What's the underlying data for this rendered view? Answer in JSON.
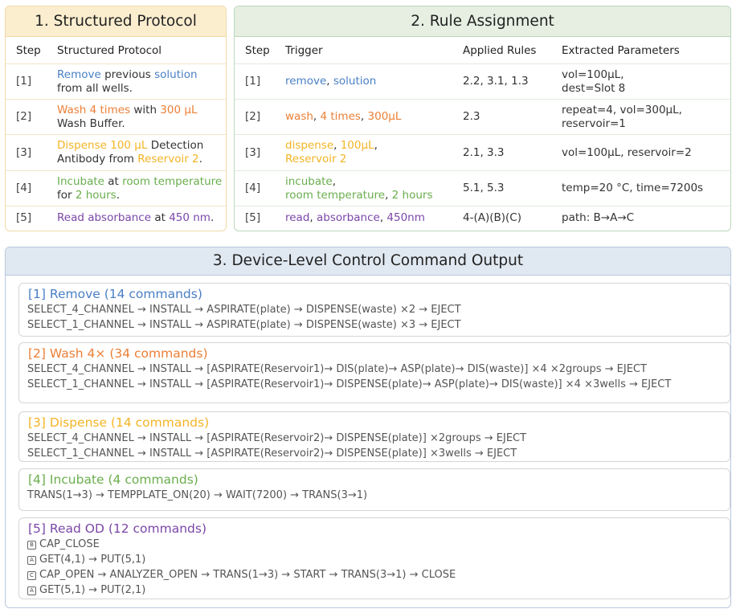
{
  "panel1": {
    "title": "1. Structured Protocol",
    "headers": [
      "Step",
      "Structured Protocol"
    ],
    "rows": [
      {
        "step": "[1]",
        "parts": [
          {
            "t": "Remove",
            "c": "blue"
          },
          {
            "t": " previous ",
            "c": "dark"
          },
          {
            "t": "solution",
            "c": "blue"
          },
          {
            "t": "\nfrom all wells.",
            "c": "dark"
          }
        ]
      },
      {
        "step": "[2]",
        "parts": [
          {
            "t": "Wash 4 times",
            "c": "orange"
          },
          {
            "t": " with ",
            "c": "dark"
          },
          {
            "t": "300 μL",
            "c": "orange"
          },
          {
            "t": "\nWash Buffer.",
            "c": "dark"
          }
        ]
      },
      {
        "step": "[3]",
        "parts": [
          {
            "t": "Dispense 100 μL",
            "c": "yellow"
          },
          {
            "t": " Detection\nAntibody from ",
            "c": "dark"
          },
          {
            "t": "Reservoir 2",
            "c": "yellow"
          },
          {
            "t": ".",
            "c": "dark"
          }
        ]
      },
      {
        "step": "[4]",
        "parts": [
          {
            "t": "Incubate",
            "c": "green"
          },
          {
            "t": " at ",
            "c": "dark"
          },
          {
            "t": "room temperature",
            "c": "green"
          },
          {
            "t": "\nfor ",
            "c": "dark"
          },
          {
            "t": "2 hours",
            "c": "green"
          },
          {
            "t": ".",
            "c": "dark"
          }
        ]
      },
      {
        "step": "[5]",
        "parts": [
          {
            "t": "Read absorbance",
            "c": "purple"
          },
          {
            "t": " at ",
            "c": "dark"
          },
          {
            "t": "450 nm",
            "c": "purple"
          },
          {
            "t": ".",
            "c": "dark"
          }
        ]
      }
    ]
  },
  "panel2": {
    "title": "2. Rule Assignment",
    "headers": [
      "Step",
      "Trigger",
      "Applied Rules",
      "Extracted Parameters"
    ],
    "rows": [
      {
        "step": "[1]",
        "trigger": [
          {
            "t": "remove",
            "c": "blue"
          },
          {
            "t": ", ",
            "c": "dark"
          },
          {
            "t": "solution",
            "c": "blue"
          }
        ],
        "rules": "2.2, 3.1, 1.3",
        "params": "vol=100μL,\ndest=Slot 8"
      },
      {
        "step": "[2]",
        "trigger": [
          {
            "t": "wash",
            "c": "orange"
          },
          {
            "t": ", ",
            "c": "dark"
          },
          {
            "t": "4 times",
            "c": "orange"
          },
          {
            "t": ", ",
            "c": "dark"
          },
          {
            "t": "300μL",
            "c": "orange"
          }
        ],
        "rules": "2.3",
        "params": "repeat=4, vol=300μL,\nreservoir=1"
      },
      {
        "step": "[3]",
        "trigger": [
          {
            "t": "dispense",
            "c": "yellow"
          },
          {
            "t": ", ",
            "c": "dark"
          },
          {
            "t": "100μL",
            "c": "yellow"
          },
          {
            "t": ",\n",
            "c": "dark"
          },
          {
            "t": "Reservoir 2",
            "c": "yellow"
          }
        ],
        "rules": "2.1, 3.3",
        "params": "vol=100μL, reservoir=2"
      },
      {
        "step": "[4]",
        "trigger": [
          {
            "t": "incubate",
            "c": "green"
          },
          {
            "t": ",\n",
            "c": "dark"
          },
          {
            "t": "room temperature",
            "c": "green"
          },
          {
            "t": ", ",
            "c": "dark"
          },
          {
            "t": "2 hours",
            "c": "green"
          }
        ],
        "rules": "5.1, 5.3",
        "params": "temp=20 °C, time=7200s"
      },
      {
        "step": "[5]",
        "trigger": [
          {
            "t": "read",
            "c": "purple"
          },
          {
            "t": ", ",
            "c": "dark"
          },
          {
            "t": "absorbance",
            "c": "purple"
          },
          {
            "t": ", ",
            "c": "dark"
          },
          {
            "t": "450nm",
            "c": "purple"
          }
        ],
        "rules": "4-(A)(B)(C)",
        "params": "path: B→A→C"
      }
    ]
  },
  "panel3": {
    "title": "3. Device-Level Control Command Output",
    "blocks": [
      {
        "head": "[1] Remove (14 commands)",
        "c": "blue",
        "lines": [
          {
            "tag": "",
            "text": "SELECT_4_CHANNEL → INSTALL → ASPIRATE(plate) → DISPENSE(waste) ×2 → EJECT"
          },
          {
            "tag": "",
            "text": "SELECT_1_CHANNEL → INSTALL → ASPIRATE(plate) → DISPENSE(waste) ×3 → EJECT"
          }
        ]
      },
      {
        "head": "[2] Wash 4× (34 commands)",
        "c": "orange",
        "lines": [
          {
            "tag": "",
            "text": "SELECT_4_CHANNEL → INSTALL → [ASPIRATE(Reservoir1)→ DIS(plate)→ ASP(plate)→ DIS(waste)] ×4 ×2groups → EJECT"
          },
          {
            "tag": "",
            "text": "SELECT_1_CHANNEL → INSTALL → [ASPIRATE(Reservoir1)→ DISPENSE(plate)→ ASP(plate)→ DIS(waste)] ×4 ×3wells → EJECT"
          }
        ]
      },
      {
        "head": "[3] Dispense (14 commands)",
        "c": "yellow",
        "lines": [
          {
            "tag": "",
            "text": "SELECT_4_CHANNEL → INSTALL → [ASPIRATE(Reservoir2)→ DISPENSE(plate)] ×2groups → EJECT"
          },
          {
            "tag": "",
            "text": "SELECT_1_CHANNEL → INSTALL → [ASPIRATE(Reservoir2)→ DISPENSE(plate)] ×3wells → EJECT"
          }
        ]
      },
      {
        "head": "[4] Incubate (4 commands)",
        "c": "green",
        "lines": [
          {
            "tag": "",
            "text": "TRANS(1→3) → TEMPPLATE_ON(20) → WAIT(7200) → TRANS(3→1)"
          }
        ]
      },
      {
        "head": "[5] Read OD (12 commands)",
        "c": "purple",
        "lines": [
          {
            "tag": "B",
            "text": "CAP_CLOSE"
          },
          {
            "tag": "A",
            "text": "GET(4,1) → PUT(5,1)"
          },
          {
            "tag": "C",
            "text": "CAP_OPEN → ANALYZER_OPEN → TRANS(1→3) → START → TRANS(3→1) → CLOSE"
          },
          {
            "tag": "A",
            "text": "GET(5,1) → PUT(2,1)"
          }
        ]
      }
    ]
  }
}
